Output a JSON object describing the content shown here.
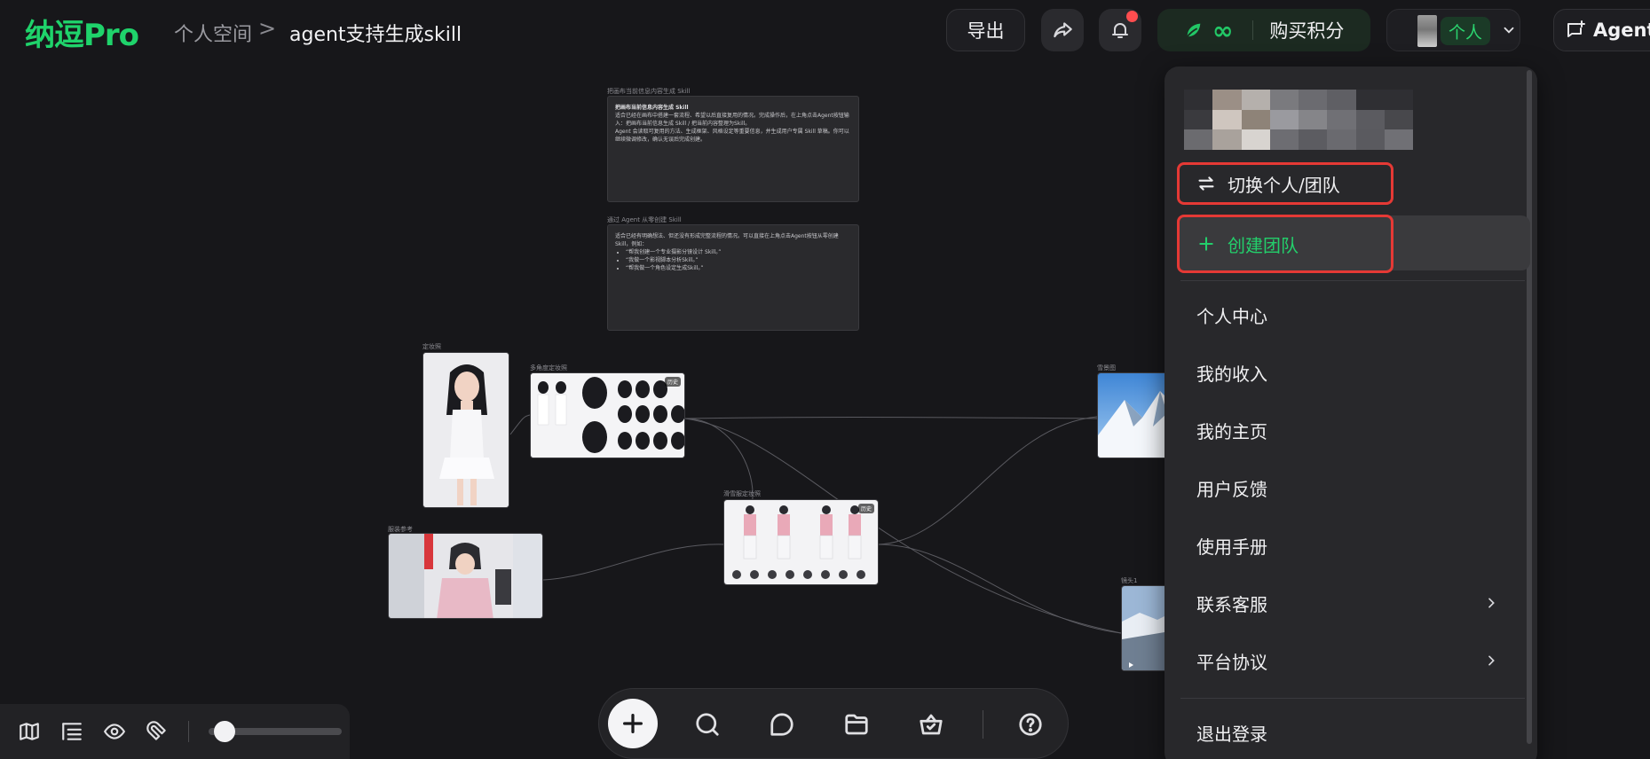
{
  "header": {
    "logo": "纳逗Pro",
    "breadcrumb": {
      "parent": "个人空间",
      "separator": ">",
      "current": "agent支持生成skill"
    },
    "export_label": "导出",
    "credits": {
      "symbol": "∞",
      "buy_label": "购买积分"
    },
    "user": {
      "mode_tag": "个人"
    },
    "agent_label": "Agent"
  },
  "canvas": {
    "text_cards": [
      {
        "label": "把画布当前信息内容生成 Skill",
        "title": "把画布当前信息内容生成 Skill",
        "lines": [
          "适合已经在画布中搭建一套流程、希望以后直接复用的情况。完成操作后，在上角点击Agent按钮输入：把画布当前信息生成 Skill / 把当前内容整理为Skill。",
          "Agent 会读取可复用的方法、生成框架、风格设定等重要信息，并生成用户专属 Skill 草稿。你可以继续微调修改，确认无误后完成创建。"
        ]
      },
      {
        "label": "通过 Agent 从零创建 Skill",
        "title": "",
        "lines": [
          "适合已经有明确想法、但还没有形成完整流程的情况。可以直接在上角点击Agent按钮从零创建Skill，例如："
        ],
        "bullets": [
          "“帮我创建一个专业摄影分镜设计 Skill。”",
          "“我做一个影视脚本分析Skill。”",
          "“帮我做一个角色设定生成Skill。”"
        ]
      }
    ],
    "image_nodes": [
      {
        "label": "定妆照",
        "badge": ""
      },
      {
        "label": "多角度定妆照",
        "badge": "历史"
      },
      {
        "label": "服装参考",
        "badge": ""
      },
      {
        "label": "滑雪服定妆照",
        "badge": "历史"
      },
      {
        "label": "雪景图",
        "badge": ""
      },
      {
        "label": "镜头1",
        "badge": ""
      }
    ]
  },
  "user_menu": {
    "switch_label": "切换个人/团队",
    "create_team_label": "创建团队",
    "items": [
      {
        "label": "个人中心",
        "has_submenu": false
      },
      {
        "label": "我的收入",
        "has_submenu": false
      },
      {
        "label": "我的主页",
        "has_submenu": false
      },
      {
        "label": "用户反馈",
        "has_submenu": false
      },
      {
        "label": "使用手册",
        "has_submenu": false
      },
      {
        "label": "联系客服",
        "has_submenu": true
      },
      {
        "label": "平台协议",
        "has_submenu": true
      }
    ],
    "logout_label": "退出登录",
    "colors": {
      "highlight_border": "#e53935",
      "accent_green": "#23cf6b"
    }
  },
  "bottom_toolbar": {
    "left_icons": [
      "map-icon",
      "layout-icon",
      "eye-icon",
      "magnet-icon"
    ],
    "zoom_slider_value": 0.05,
    "center_icons": [
      "add-icon",
      "search-icon",
      "chat-icon",
      "folder-icon",
      "basket-icon",
      "help-icon"
    ]
  }
}
